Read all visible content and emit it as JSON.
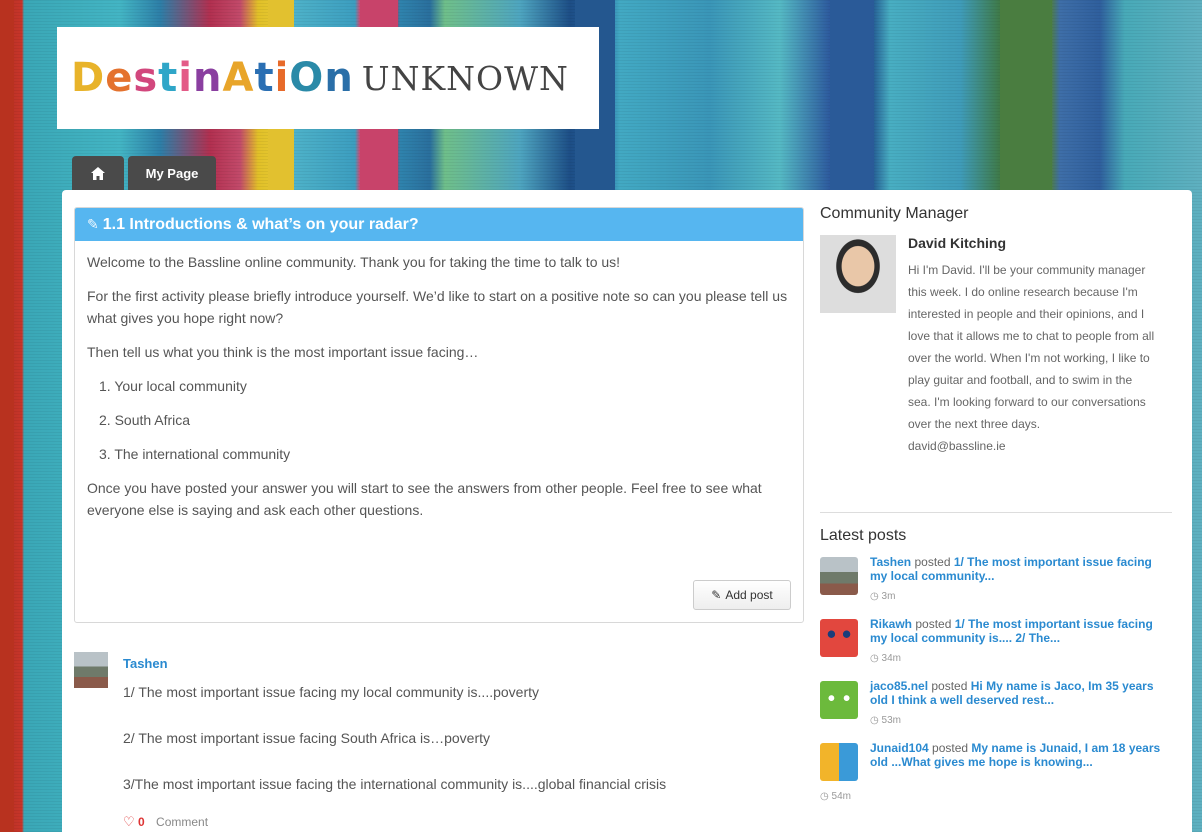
{
  "logo": {
    "word": [
      "D",
      "e",
      "s",
      "t",
      "i",
      "n",
      "A",
      "t",
      "i",
      "O",
      "n"
    ],
    "sub": "UNKNOWN"
  },
  "nav": {
    "home_icon": "home-icon",
    "my_page": "My Page"
  },
  "activity": {
    "title": "1.1 Introductions & what’s on your radar?",
    "intro": "Welcome to the Bassline online community. Thank you for taking the time to talk to us!",
    "para1": "For the first activity please briefly introduce yourself. We’d like to start on a positive note so can you please tell us what gives you hope right now?",
    "para2": "Then tell us what you think is the most important issue facing…",
    "items": [
      "1. Your local community",
      "2. South Africa",
      "3. The international community"
    ],
    "para3": "Once you have posted your answer you will start to see the answers from other people. Feel free to see what everyone else is saying and ask each other questions.",
    "add_post": "Add post"
  },
  "post": {
    "author": "Tashen",
    "lines": [
      "1/ The most important issue facing my local community is....poverty",
      "2/ The most important issue facing South Africa is…poverty",
      "3/The most important issue facing the international community is....global financial crisis"
    ],
    "likes": "0",
    "comment": "Comment"
  },
  "manager": {
    "heading": "Community Manager",
    "name": "David Kitching",
    "bio": "Hi I'm David. I'll be your community manager this week. I do online research because I'm interested in people and their opinions, and I love that it allows me to chat to people from all over the world. When I'm not working, I like to play guitar and football, and to swim in the sea. I'm looking forward to our conversations over the next three days.",
    "email": "david@bassline.ie"
  },
  "latest": {
    "heading": "Latest posts",
    "posted_word": "posted",
    "items": [
      {
        "who": "Tashen",
        "what": "1/ The most important issue facing my local community...",
        "time": "3m"
      },
      {
        "who": "Rikawh",
        "what": "1/ The most important issue facing my local community is.... 2/ The...",
        "time": "34m"
      },
      {
        "who": "jaco85.nel",
        "what": "Hi My name is Jaco, Im 35 years old I think a well deserved rest...",
        "time": "53m"
      },
      {
        "who": "Junaid104",
        "what": "My name is Junaid, I am 18 years old ...What gives me hope is knowing...",
        "time": "54m"
      }
    ]
  },
  "colors": {
    "accent_blue": "#56b6f0",
    "link_blue": "#2a8ad0",
    "tab_dark": "#4a4a4a"
  }
}
